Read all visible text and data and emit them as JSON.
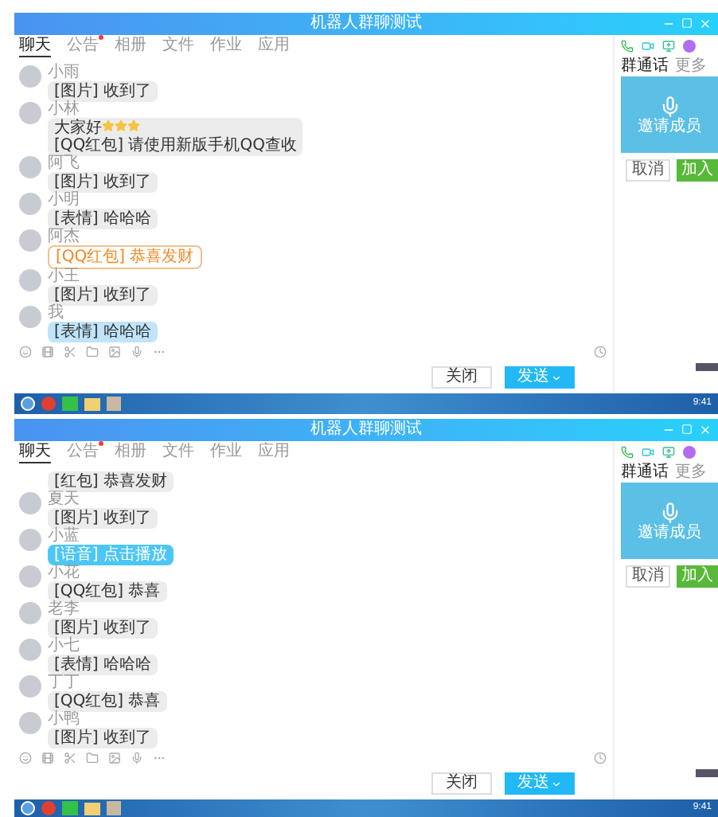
{
  "windows": [
    {
      "title": "机器人群聊测试",
      "tabs": [
        {
          "label": "聊天",
          "selected": true,
          "unread": false
        },
        {
          "label": "公告",
          "selected": false,
          "unread": true
        },
        {
          "label": "相册",
          "selected": false,
          "unread": false
        },
        {
          "label": "文件",
          "selected": false,
          "unread": false
        },
        {
          "label": "作业",
          "selected": false,
          "unread": false
        },
        {
          "label": "应用",
          "selected": false,
          "unread": false
        }
      ],
      "messages": [
        {
          "sender": "小雨",
          "text": "[图片] 收到了",
          "kind": "normal"
        },
        {
          "sender": "小林",
          "text": "大家好",
          "text2": "[QQ红包] 请使用新版手机QQ查收",
          "kind": "stars"
        },
        {
          "sender": "阿飞",
          "text": "[图片] 收到了",
          "kind": "normal"
        },
        {
          "sender": "小明",
          "text": "[表情] 哈哈哈",
          "kind": "normal"
        },
        {
          "sender": "阿杰",
          "text": "[QQ红包] 恭喜发财",
          "kind": "orange"
        },
        {
          "sender": "小王",
          "text": "[图片] 收到了",
          "kind": "normal"
        },
        {
          "sender": "我",
          "text": "[表情] 哈哈哈",
          "kind": "self"
        }
      ],
      "panel": {
        "tabs": [
          {
            "label": "群通话",
            "selected": true
          },
          {
            "label": "更多",
            "selected": false
          }
        ],
        "card_text": "邀请成员",
        "buttons": [
          {
            "label": "取消",
            "kind": "plain"
          },
          {
            "label": "加入",
            "kind": "primary"
          }
        ]
      },
      "buttons": [
        {
          "label": "关闭",
          "kind": "plain"
        },
        {
          "label": "发送",
          "kind": "primary"
        }
      ],
      "time": "9:41"
    },
    {
      "title": "机器人群聊测试",
      "tabs": [
        {
          "label": "聊天",
          "selected": true,
          "unread": false
        },
        {
          "label": "公告",
          "selected": false,
          "unread": true
        },
        {
          "label": "相册",
          "selected": false,
          "unread": false
        },
        {
          "label": "文件",
          "selected": false,
          "unread": false
        },
        {
          "label": "作业",
          "selected": false,
          "unread": false
        },
        {
          "label": "应用",
          "selected": false,
          "unread": false
        }
      ],
      "messages": [
        {
          "text": "[红包] 恭喜发财",
          "kind": "normal"
        },
        {
          "sender": "夏天",
          "text": "[图片] 收到了",
          "kind": "normal"
        },
        {
          "sender": "小蓝",
          "text": "[语音] 点击播放",
          "kind": "blue"
        },
        {
          "sender": "小花",
          "text": "[QQ红包] 恭喜",
          "kind": "normal"
        },
        {
          "sender": "老李",
          "text": "[图片] 收到了",
          "kind": "normal"
        },
        {
          "sender": "小七",
          "text": "[表情] 哈哈哈",
          "kind": "normal"
        },
        {
          "sender": "丁丁",
          "text": "[QQ红包] 恭喜",
          "kind": "normal"
        },
        {
          "sender": "小鸭",
          "text": "[图片] 收到了",
          "kind": "normal"
        }
      ],
      "panel": {
        "tabs": [
          {
            "label": "群通话",
            "selected": true
          },
          {
            "label": "更多",
            "selected": false
          }
        ],
        "card_text": "邀请成员",
        "buttons": [
          {
            "label": "取消",
            "kind": "plain"
          },
          {
            "label": "加入",
            "kind": "primary"
          }
        ]
      },
      "buttons": [
        {
          "label": "关闭",
          "kind": "plain"
        },
        {
          "label": "发送",
          "kind": "primary"
        }
      ],
      "time": "9:41"
    }
  ]
}
